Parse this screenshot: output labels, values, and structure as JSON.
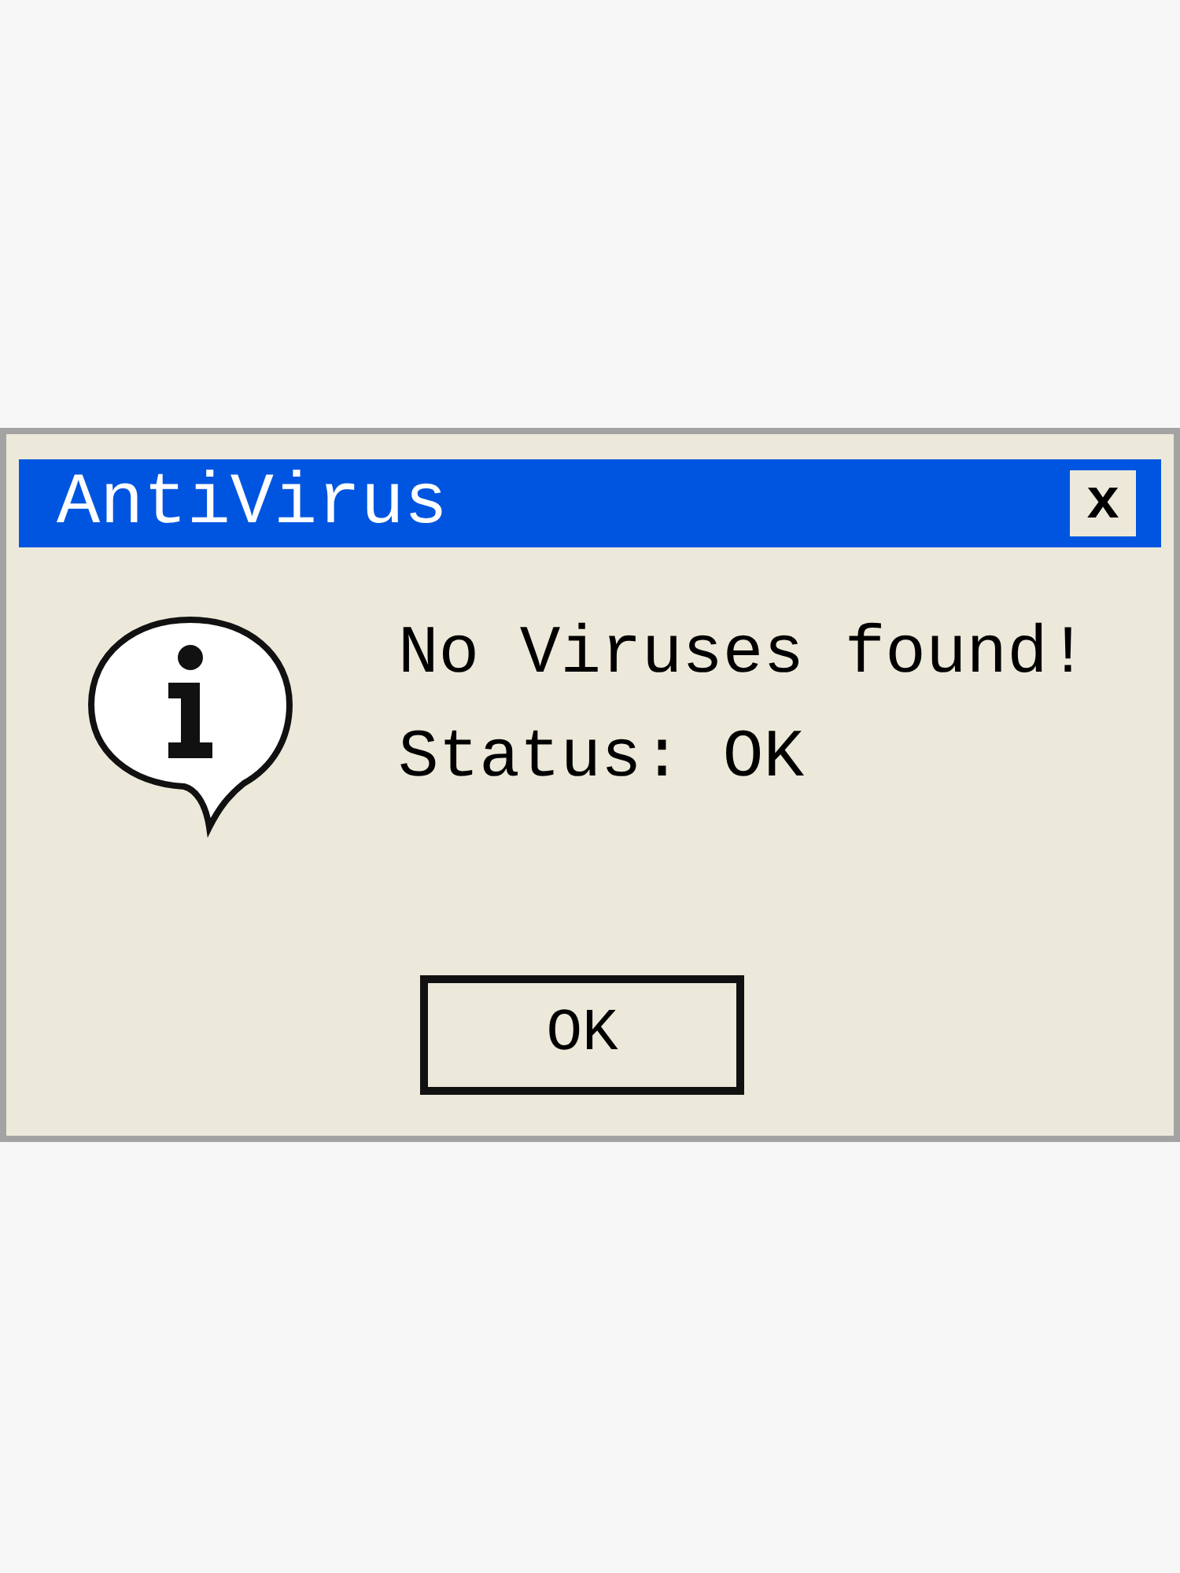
{
  "window": {
    "title": "AntiVirus",
    "close_label": "x"
  },
  "message": {
    "lines": [
      "No Viruses found!",
      "Status: OK"
    ]
  },
  "buttons": [
    "OK"
  ]
}
